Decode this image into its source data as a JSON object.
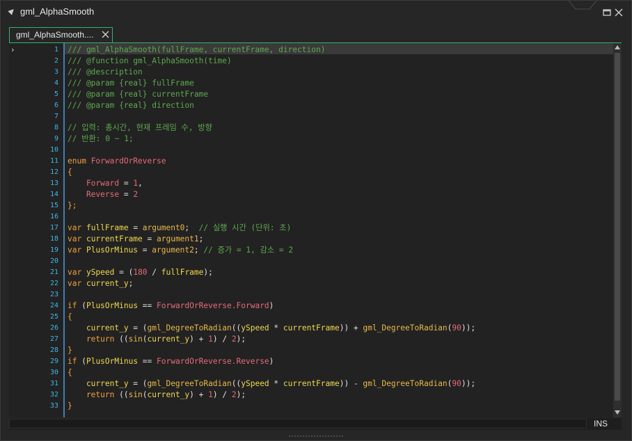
{
  "window": {
    "title": "gml_AlphaSmooth",
    "tab_label": "gml_AlphaSmooth....",
    "icons": [
      "collapse-arrow-icon",
      "maximize-icon",
      "close-icon"
    ]
  },
  "editor": {
    "lines": [
      [
        {
          "t": "/// gml_AlphaSmooth(fullFrame, currentFrame, direction)",
          "c": "c"
        }
      ],
      [
        {
          "t": "/// @function gml_AlphaSmooth(time)",
          "c": "c"
        }
      ],
      [
        {
          "t": "/// @description",
          "c": "c"
        }
      ],
      [
        {
          "t": "/// @param {real} fullFrame",
          "c": "c"
        }
      ],
      [
        {
          "t": "/// @param {real} currentFrame",
          "c": "c"
        }
      ],
      [
        {
          "t": "/// @param {real} direction",
          "c": "c"
        }
      ],
      [],
      [
        {
          "t": "// 입력: 총시간, 현재 프레임 수, 방향",
          "c": "c"
        }
      ],
      [
        {
          "t": "// 반환: 0 ~ 1;",
          "c": "c"
        }
      ],
      [],
      [
        {
          "t": "enum ",
          "c": "k"
        },
        {
          "t": "ForwardOrReverse",
          "c": "t"
        }
      ],
      [
        {
          "t": "{",
          "c": "k"
        }
      ],
      [
        {
          "t": "    Forward ",
          "c": "t"
        },
        {
          "t": "= ",
          "c": "a"
        },
        {
          "t": "1",
          "c": "n"
        },
        {
          "t": ",",
          "c": "a"
        }
      ],
      [
        {
          "t": "    Reverse ",
          "c": "t"
        },
        {
          "t": "= ",
          "c": "a"
        },
        {
          "t": "2",
          "c": "n"
        }
      ],
      [
        {
          "t": "};",
          "c": "k"
        }
      ],
      [],
      [
        {
          "t": "var ",
          "c": "k"
        },
        {
          "t": "fullFrame ",
          "c": "v"
        },
        {
          "t": "= ",
          "c": "a"
        },
        {
          "t": "argument0",
          "c": "f"
        },
        {
          "t": ";  ",
          "c": "a"
        },
        {
          "t": "// 실행 시간 (단위: 초)",
          "c": "c"
        }
      ],
      [
        {
          "t": "var ",
          "c": "k"
        },
        {
          "t": "currentFrame ",
          "c": "v"
        },
        {
          "t": "= ",
          "c": "a"
        },
        {
          "t": "argument1",
          "c": "f"
        },
        {
          "t": ";",
          "c": "a"
        }
      ],
      [
        {
          "t": "var ",
          "c": "k"
        },
        {
          "t": "PlusOrMinus ",
          "c": "v"
        },
        {
          "t": "= ",
          "c": "a"
        },
        {
          "t": "argument2",
          "c": "f"
        },
        {
          "t": "; ",
          "c": "a"
        },
        {
          "t": "// 증가 = 1, 감소 = 2",
          "c": "c"
        }
      ],
      [],
      [
        {
          "t": "var ",
          "c": "k"
        },
        {
          "t": "ySpeed ",
          "c": "v"
        },
        {
          "t": "= (",
          "c": "a"
        },
        {
          "t": "180",
          "c": "n"
        },
        {
          "t": " / ",
          "c": "a"
        },
        {
          "t": "fullFrame",
          "c": "v"
        },
        {
          "t": ");",
          "c": "a"
        }
      ],
      [
        {
          "t": "var ",
          "c": "k"
        },
        {
          "t": "current_y",
          "c": "v"
        },
        {
          "t": ";",
          "c": "a"
        }
      ],
      [],
      [
        {
          "t": "if ",
          "c": "k"
        },
        {
          "t": "(",
          "c": "a"
        },
        {
          "t": "PlusOrMinus ",
          "c": "v"
        },
        {
          "t": "== ",
          "c": "a"
        },
        {
          "t": "ForwardOrReverse.Forward",
          "c": "t"
        },
        {
          "t": ")",
          "c": "a"
        }
      ],
      [
        {
          "t": "{",
          "c": "k"
        }
      ],
      [
        {
          "t": "    current_y ",
          "c": "v"
        },
        {
          "t": "= (",
          "c": "a"
        },
        {
          "t": "gml_DegreeToRadian",
          "c": "f"
        },
        {
          "t": "((",
          "c": "a"
        },
        {
          "t": "ySpeed",
          "c": "v"
        },
        {
          "t": " * ",
          "c": "a"
        },
        {
          "t": "currentFrame",
          "c": "v"
        },
        {
          "t": ")) + ",
          "c": "a"
        },
        {
          "t": "gml_DegreeToRadian",
          "c": "f"
        },
        {
          "t": "(",
          "c": "a"
        },
        {
          "t": "90",
          "c": "n"
        },
        {
          "t": "));",
          "c": "a"
        }
      ],
      [
        {
          "t": "    return ",
          "c": "k"
        },
        {
          "t": "((",
          "c": "a"
        },
        {
          "t": "sin",
          "c": "f"
        },
        {
          "t": "(",
          "c": "a"
        },
        {
          "t": "current_y",
          "c": "v"
        },
        {
          "t": ") + ",
          "c": "a"
        },
        {
          "t": "1",
          "c": "n"
        },
        {
          "t": ") / ",
          "c": "a"
        },
        {
          "t": "2",
          "c": "n"
        },
        {
          "t": ");",
          "c": "a"
        }
      ],
      [
        {
          "t": "}",
          "c": "k"
        }
      ],
      [
        {
          "t": "if ",
          "c": "k"
        },
        {
          "t": "(",
          "c": "a"
        },
        {
          "t": "PlusOrMinus ",
          "c": "v"
        },
        {
          "t": "== ",
          "c": "a"
        },
        {
          "t": "ForwardOrReverse.Reverse",
          "c": "t"
        },
        {
          "t": ")",
          "c": "a"
        }
      ],
      [
        {
          "t": "{",
          "c": "k"
        }
      ],
      [
        {
          "t": "    current_y ",
          "c": "v"
        },
        {
          "t": "= (",
          "c": "a"
        },
        {
          "t": "gml_DegreeToRadian",
          "c": "f"
        },
        {
          "t": "((",
          "c": "a"
        },
        {
          "t": "ySpeed",
          "c": "v"
        },
        {
          "t": " * ",
          "c": "a"
        },
        {
          "t": "currentFrame",
          "c": "v"
        },
        {
          "t": ")) - ",
          "c": "a"
        },
        {
          "t": "gml_DegreeToRadian",
          "c": "f"
        },
        {
          "t": "(",
          "c": "a"
        },
        {
          "t": "90",
          "c": "n"
        },
        {
          "t": "));",
          "c": "a"
        }
      ],
      [
        {
          "t": "    return ",
          "c": "k"
        },
        {
          "t": "((",
          "c": "a"
        },
        {
          "t": "sin",
          "c": "f"
        },
        {
          "t": "(",
          "c": "a"
        },
        {
          "t": "current_y",
          "c": "v"
        },
        {
          "t": ") + ",
          "c": "a"
        },
        {
          "t": "1",
          "c": "n"
        },
        {
          "t": ") / ",
          "c": "a"
        },
        {
          "t": "2",
          "c": "n"
        },
        {
          "t": ");",
          "c": "a"
        }
      ],
      [
        {
          "t": "}",
          "c": "k"
        }
      ]
    ]
  },
  "status": {
    "mode": "INS"
  },
  "colors": {
    "accent": "#34b36b",
    "gutter_line": "#3e7fb5",
    "line_numbers": "#3fb6e8",
    "comment": "#5ea84f",
    "keyword": "#f0a03c"
  }
}
